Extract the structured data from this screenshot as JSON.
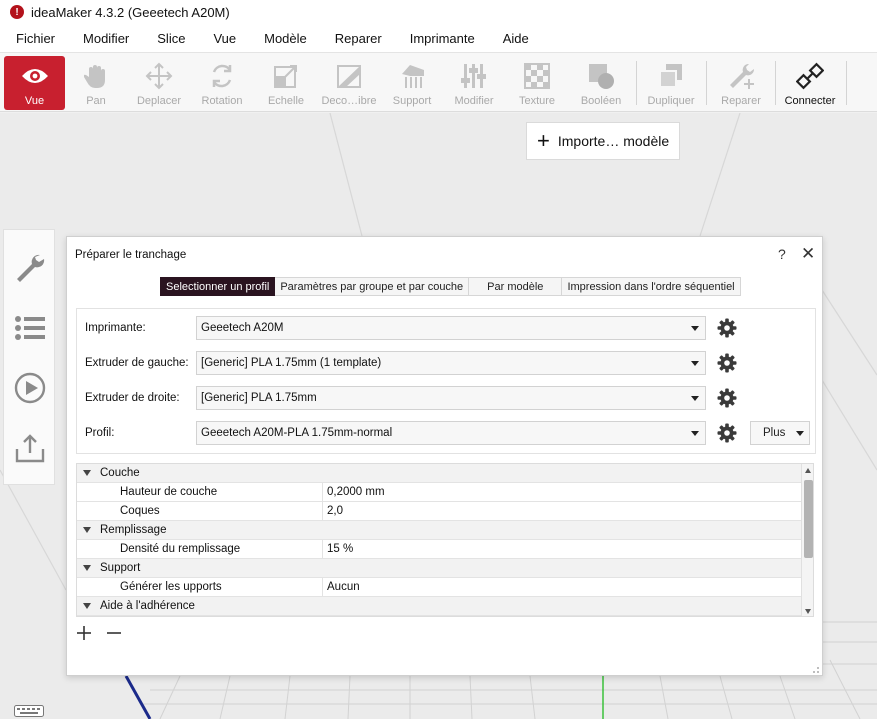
{
  "window": {
    "title": "ideaMaker 4.3.2 (Geeetech A20M)",
    "app_icon": "ideamaker-logo-icon"
  },
  "menu": [
    "Fichier",
    "Modifier",
    "Slice",
    "Vue",
    "Modèle",
    "Reparer",
    "Imprimante",
    "Aide"
  ],
  "toolbar": [
    {
      "label": "Vue",
      "icon": "eye-icon",
      "state": "active"
    },
    {
      "label": "Pan",
      "icon": "hand-icon",
      "state": "disabled"
    },
    {
      "label": "Deplacer",
      "icon": "move-icon",
      "state": "disabled"
    },
    {
      "label": "Rotation",
      "icon": "rotate-icon",
      "state": "disabled"
    },
    {
      "label": "Echelle",
      "icon": "scale-icon",
      "state": "disabled"
    },
    {
      "label": "Deco…ibre",
      "icon": "cut-icon",
      "state": "disabled"
    },
    {
      "label": "Support",
      "icon": "support-icon",
      "state": "disabled"
    },
    {
      "label": "Modifier",
      "icon": "sliders-icon",
      "state": "disabled"
    },
    {
      "label": "Texture",
      "icon": "texture-icon",
      "state": "disabled"
    },
    {
      "label": "Booléen",
      "icon": "boolean-icon",
      "state": "disabled"
    },
    {
      "label": "Dupliquer",
      "icon": "duplicate-icon",
      "state": "disabled"
    },
    {
      "label": "Reparer",
      "icon": "wrench-plus-icon",
      "state": "disabled"
    },
    {
      "label": "Connecter",
      "icon": "connect-icon",
      "state": "enabled"
    }
  ],
  "import_button": {
    "label": "Importe… modèle"
  },
  "dialog": {
    "title": "Préparer le tranchage",
    "help": "?",
    "close": "✕",
    "tabs": [
      {
        "label": "Selectionner un profil",
        "selected": true
      },
      {
        "label": "Paramètres par groupe et par couche",
        "selected": false
      },
      {
        "label": "Par modèle",
        "selected": false
      },
      {
        "label": "Impression dans l'ordre séquentiel",
        "selected": false
      }
    ],
    "profile": {
      "printer_label": "Imprimante:",
      "printer_value": "Geeetech A20M",
      "left_extruder_label": "Extruder de gauche:",
      "left_extruder_value": "[Generic] PLA 1.75mm (1 template)",
      "right_extruder_label": "Extruder de droite:",
      "right_extruder_value": "[Generic] PLA 1.75mm",
      "profile_label": "Profil:",
      "profile_value": "Geeetech A20M-PLA 1.75mm-normal",
      "more_label": "Plus"
    },
    "settings_tree": {
      "groups": [
        {
          "name": "Couche",
          "rows": [
            {
              "name": "Hauteur de couche",
              "value": "0,2000 mm"
            },
            {
              "name": "Coques",
              "value": "2,0"
            }
          ]
        },
        {
          "name": "Remplissage",
          "rows": [
            {
              "name": "Densité du remplissage",
              "value": "15 %"
            }
          ]
        },
        {
          "name": "Support",
          "rows": [
            {
              "name": "Générer les upports",
              "value": "Aucun"
            }
          ]
        },
        {
          "name": "Aide à l'adhérence",
          "rows": []
        }
      ]
    }
  },
  "colors": {
    "accent": "#c8202f",
    "tab_selected": "#2a1420"
  }
}
